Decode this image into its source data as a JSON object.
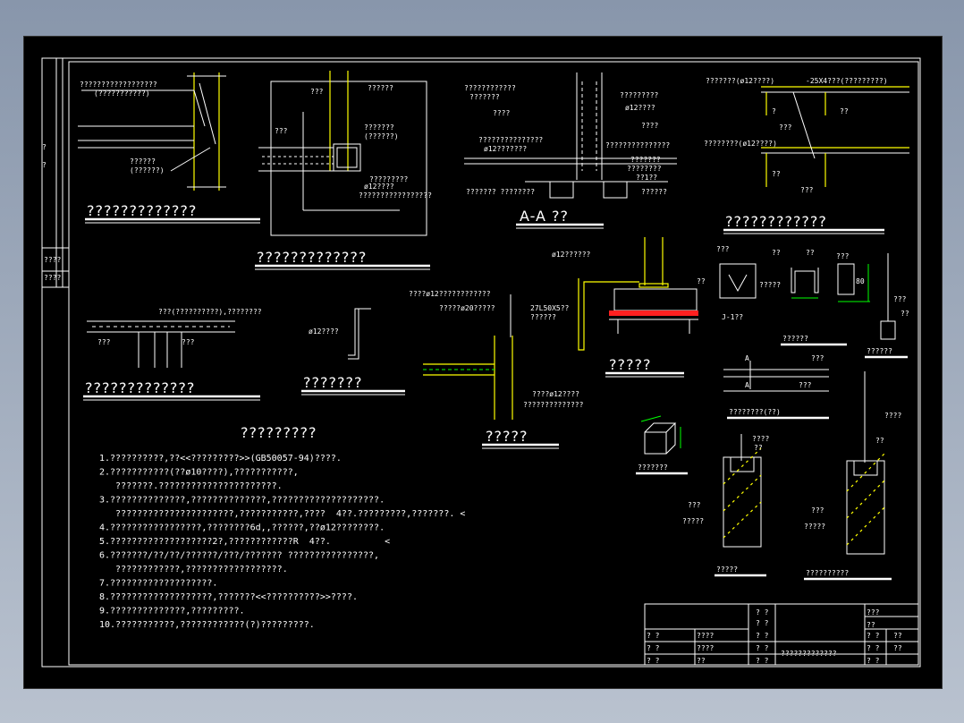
{
  "titles": {
    "d1": "?????????????",
    "d2": "?????????????",
    "d3": "A-A  ??",
    "d4": "????????????",
    "d5": "?????????????",
    "d6": "???????",
    "d7": "?????",
    "d8": "?????",
    "d9": "??????",
    "d10": "??????",
    "d11": "????????(??)",
    "d12": "???????",
    "d13": "?????",
    "d14": "??????????",
    "notes": "?????????",
    "section_j": "J-1??"
  },
  "labels": {
    "l1": "??????????????????",
    "l2": "(???????????)",
    "l3": "??????",
    "l4": "(??????)",
    "l5": "???",
    "l6": "??????",
    "l7": "???",
    "l8": "???????",
    "l9": "(??????)",
    "l10": "ø12????",
    "l11": "?????????",
    "l12": "?????????????????",
    "l13": "????????????",
    "l14": "???????",
    "l15": "????",
    "l16": "???????????????",
    "l17": "ø12???????",
    "l18": "?????????",
    "l19": "ø12????",
    "l20": "????",
    "l21": "???????????????",
    "l22": "???????",
    "l23": "????????",
    "l24": "??1??",
    "l25": "??????? ????????",
    "l26": "??????",
    "l27": "???????(ø12????)",
    "l28": "-25X4???(?????????)",
    "l29": "?",
    "l30": "??",
    "l31": "???",
    "l32": "????????(ø12????)",
    "l33": "??",
    "l34": "???(??????????),????????",
    "l35": "???",
    "l36": "???",
    "l37": "ø12????",
    "l38": "????ø12????????????",
    "l39": "?????ø20?????",
    "l40": "27L50X5??",
    "l41": "??????",
    "l42": "????ø12????",
    "l43": "??????????????",
    "l44": "ø12??????",
    "l45": "???",
    "l46": "??",
    "l47": "?????",
    "l48": "??",
    "l49": "??",
    "l50": "80",
    "l51": "???",
    "l52": "???",
    "l53": "??",
    "l54": "A",
    "l55": "A",
    "l56": "???",
    "l57": "???",
    "l58": "????",
    "l59": "??",
    "l60": "??",
    "l61": "???",
    "l62": "?????",
    "l63": "????",
    "l64": "???",
    "l65": "?????"
  },
  "notes": [
    "1.??????????,??<<?????????>>(GB50057-94)????.",
    "2.???????????(??ø10????),???????????,",
    "   ???????.??????????????????????.",
    "3.??????????????,??????????????,????????????????????.",
    "   ??????????????????????,???????????,????  4??.?????????,???????. <",
    "4.?????????????????,????????6d,,??????,??ø12????????.",
    "5.???????????????????2?,????????????R  4??.          <",
    "6.???????/??/??/??????/???/??????? ????????????????,",
    "   ????????????,??????????????????.",
    "7.???????????????????.",
    "8.???????????????????,???????<<??????????>>????.",
    "9.??????????????,?????????.",
    "10.???????????,????????????(?)?????????."
  ],
  "title_block": {
    "r1": [
      "? ?",
      "? ?",
      "???"
    ],
    "r2": [
      "? ?",
      "????",
      "? ?",
      "? ?",
      "??"
    ],
    "r3": [
      "? ?",
      "????",
      "? ?",
      "? ?",
      "??"
    ],
    "r4": [
      "? ?",
      "??",
      "? ?",
      "? ?"
    ],
    "project": "?????????????",
    "r0": [
      "? ?",
      "??"
    ]
  }
}
